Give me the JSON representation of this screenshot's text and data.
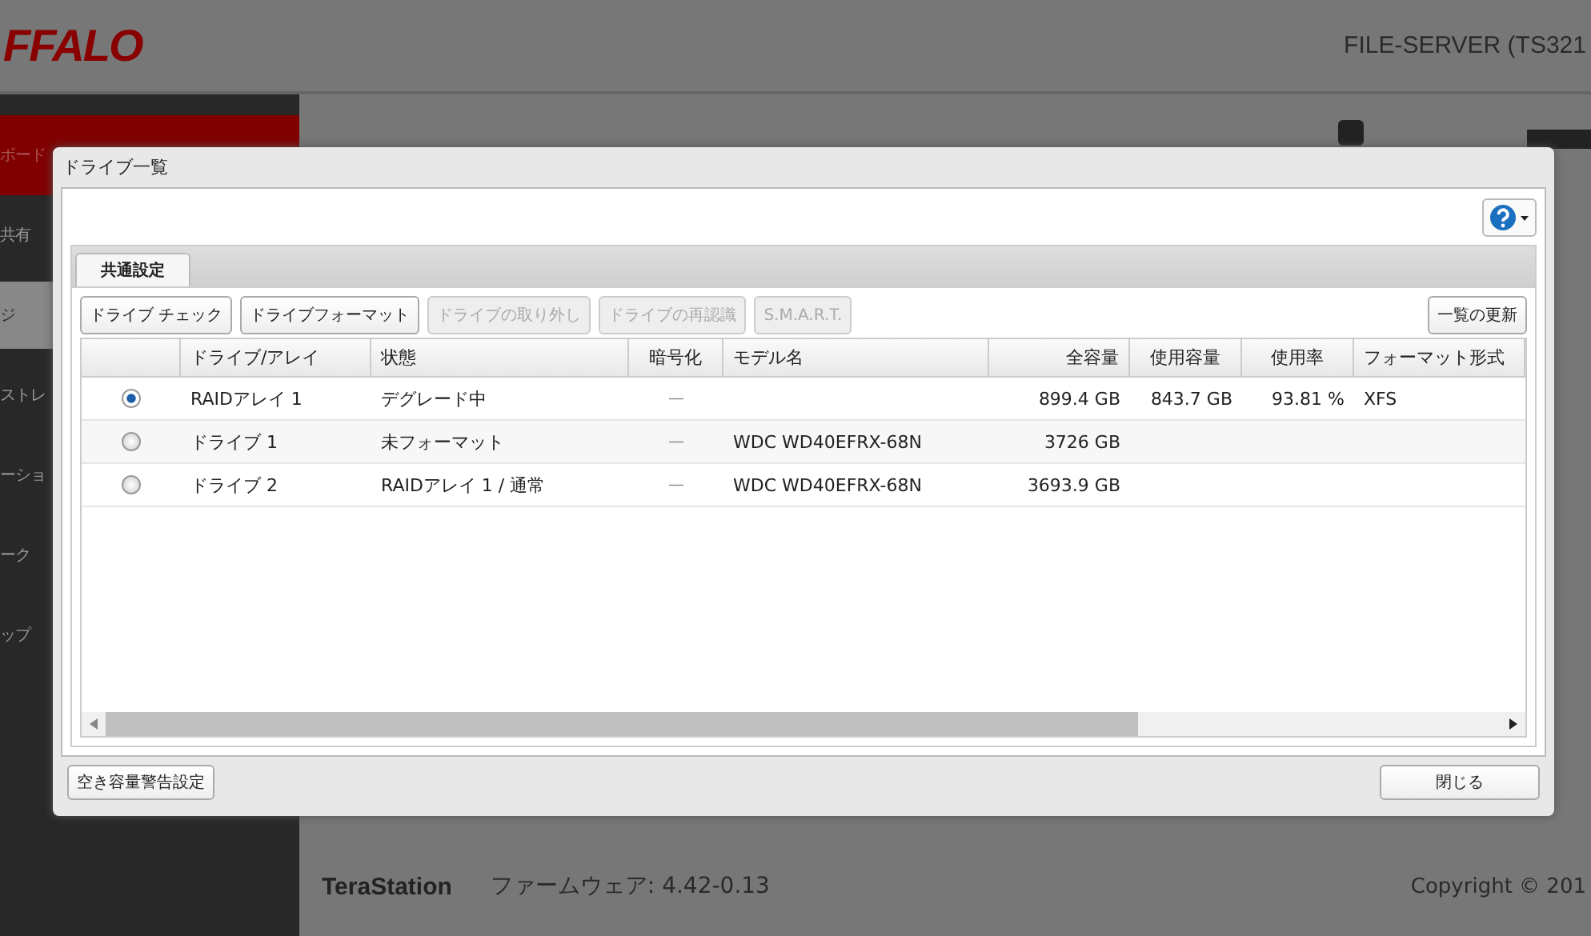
{
  "header": {
    "logo": "FFALO",
    "device": "FILE-SERVER (TS321"
  },
  "sidebar": {
    "items": [
      {
        "label": "ボード",
        "selected": false,
        "highlighted": true
      },
      {
        "label": "共有",
        "selected": false
      },
      {
        "label": "ジ",
        "selected": true
      },
      {
        "label": "ストレ",
        "selected": false
      },
      {
        "label": "ーショ",
        "selected": false
      },
      {
        "label": "ーク",
        "selected": false
      },
      {
        "label": "ップ",
        "selected": false
      }
    ]
  },
  "footer": {
    "product": "TeraStation",
    "firmware": "ファームウェア: 4.42-0.13",
    "copyright": "Copyright © 201"
  },
  "dialog": {
    "title": "ドライブ一覧",
    "tabs": [
      {
        "label": "共通設定",
        "selected": true
      }
    ],
    "toolbar": [
      {
        "label": "ドライブ チェック",
        "disabled": false
      },
      {
        "label": "ドライブフォーマット",
        "disabled": false
      },
      {
        "label": "ドライブの取り外し",
        "disabled": true
      },
      {
        "label": "ドライブの再認識",
        "disabled": true
      },
      {
        "label": "S.M.A.R.T.",
        "disabled": true
      }
    ],
    "refresh": "一覧の更新",
    "table": {
      "columns": [
        "ドライブ/アレイ",
        "状態",
        "暗号化",
        "モデル名",
        "全容量",
        "使用容量",
        "使用率",
        "フォーマット形式"
      ],
      "rows": [
        {
          "selected": true,
          "cells": [
            "RAIDアレイ 1",
            "デグレード中",
            "—",
            "",
            "899.4 GB",
            "843.7 GB",
            "93.81 %",
            "XFS"
          ]
        },
        {
          "selected": false,
          "cells": [
            "ドライブ 1",
            "未フォーマット",
            "—",
            "WDC WD40EFRX-68N",
            "3726 GB",
            "",
            "",
            ""
          ]
        },
        {
          "selected": false,
          "cells": [
            "ドライブ 2",
            "RAIDアレイ 1 / 通常",
            "—",
            "WDC WD40EFRX-68N",
            "3693.9 GB",
            "",
            "",
            ""
          ]
        }
      ]
    },
    "buttons": {
      "left": "空き容量警告設定",
      "right": "閉じる"
    }
  }
}
